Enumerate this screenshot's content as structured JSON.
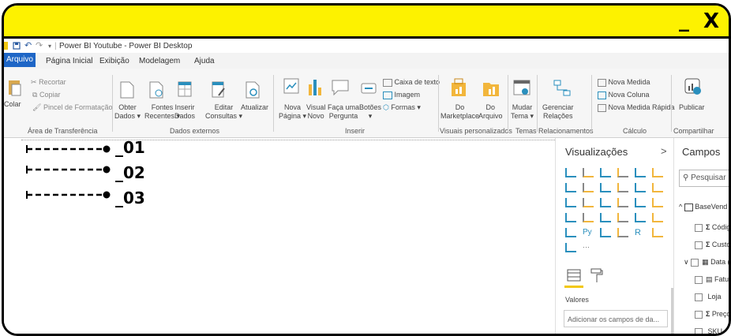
{
  "overlay": {
    "minimize_label": "_",
    "close_label": "X"
  },
  "titlebar": {
    "title": "Power BI Youtube - Power BI Desktop"
  },
  "menu": {
    "tabs": [
      "Arquivo",
      "Página Inicial",
      "Exibição",
      "Modelagem",
      "Ajuda"
    ]
  },
  "ribbon": {
    "clipboard": {
      "paste": "Colar",
      "cut": "Recortar",
      "copy": "Copiar",
      "format_painter": "Pincel de Formatação",
      "group": "Área de Transferência"
    },
    "external": {
      "get_data_1": "Obter",
      "get_data_2": "Dados ▾",
      "recent_1": "Fontes",
      "recent_2": "Recentes ▾",
      "enter_1": "Inserir",
      "enter_2": "Dados",
      "edit_1": "Editar",
      "edit_2": "Consultas ▾",
      "refresh": "Atualizar",
      "group": "Dados externos"
    },
    "insert": {
      "newpage_1": "Nova",
      "newpage_2": "Página ▾",
      "visual_1": "Visual",
      "visual_2": "Novo",
      "ask_1": "Faça uma",
      "ask_2": "Pergunta",
      "buttons_1": "Botões",
      "buttons_2": "▾",
      "textbox": "Caixa de texto",
      "image": "Imagem",
      "shapes": "Formas ▾",
      "group": "Inserir"
    },
    "custom": {
      "market_1": "Do",
      "market_2": "Marketplace",
      "file_1": "Do",
      "file_2": "Arquivo",
      "group": "Visuais personalizados"
    },
    "themes": {
      "switch_1": "Mudar",
      "switch_2": "Tema ▾",
      "group": "Temas"
    },
    "relations": {
      "manage_1": "Gerenciar",
      "manage_2": "Relações",
      "group": "Relacionamentos"
    },
    "calc": {
      "new_measure": "Nova Medida",
      "new_column": "Nova Coluna",
      "quick_measure": "Nova Medida Rápida",
      "group": "Cálculo"
    },
    "share": {
      "publish": "Publicar",
      "group": "Compartilhar"
    }
  },
  "annotations": [
    "_01",
    "_02",
    "_03"
  ],
  "visualizations": {
    "title": "Visualizações",
    "chevron": ">",
    "values_label": "Valores",
    "drop_placeholder": "Adicionar os campos de da..."
  },
  "fields": {
    "title": "Campos",
    "search_placeholder": "Pesquisar",
    "table": "BaseVend",
    "items": [
      "Códig",
      "Custo",
      "Data (",
      "Fatura",
      "Loja",
      "Preço",
      "SKU"
    ]
  }
}
